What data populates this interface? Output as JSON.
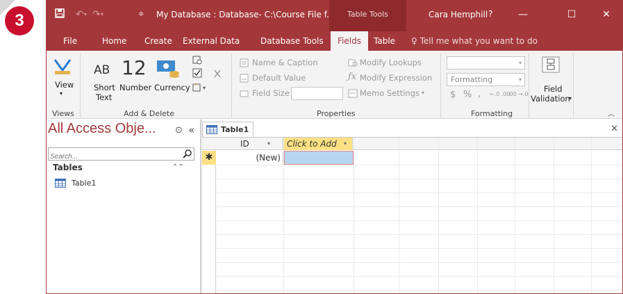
{
  "step_badge": "3",
  "window": {
    "title": "My Database : Database- C:\\Course File f...",
    "context_tab": "Table Tools",
    "user": "Cara Hemphill",
    "help": "?",
    "minimize": "—",
    "maximize": "☐",
    "close": "✕"
  },
  "ribbon_tabs": {
    "file": "File",
    "home": "Home",
    "create": "Create",
    "external_data": "External Data",
    "database_tools": "Database Tools",
    "fields": "Fields",
    "table": "Table",
    "tell_me": "Tell me what you want to do"
  },
  "ribbon": {
    "views": {
      "view_label": "View",
      "group": "Views"
    },
    "add_delete": {
      "short_text_line1": "Short",
      "short_text_line2": "Text",
      "short_text_icon": "AB",
      "number": "Number",
      "number_icon": "12",
      "currency": "Currency",
      "group": "Add & Delete"
    },
    "properties": {
      "name_caption": "Name & Caption",
      "default_value": "Default Value",
      "field_size": "Field Size",
      "modify_lookups": "Modify Lookups",
      "modify_expression": "Modify Expression",
      "memo_settings": "Memo Settings",
      "group": "Properties"
    },
    "formatting": {
      "format_value": "Formatting",
      "dollar": "$",
      "percent": "%",
      "comma": ",",
      "inc_decimals": "←.0 .00",
      "dec_decimals": ".00 →.0",
      "group": "Formatting"
    },
    "validation": {
      "line1": "Field",
      "line2": "Validation"
    }
  },
  "nav_pane": {
    "title": "All Access Obje...",
    "search_placeholder": "Search...",
    "section": "Tables",
    "items": [
      "Table1"
    ]
  },
  "document": {
    "tab_label": "Table1",
    "columns": [
      "ID",
      "Click to Add"
    ],
    "new_row": {
      "marker": "✱",
      "id": "(New)",
      "add": ""
    }
  },
  "colors": {
    "access_red": "#a4373a",
    "context_red": "#8e2a2d",
    "badge_red": "#c8102e",
    "header_yellow": "#fce083",
    "selected_cell": "#b8d5f0"
  }
}
